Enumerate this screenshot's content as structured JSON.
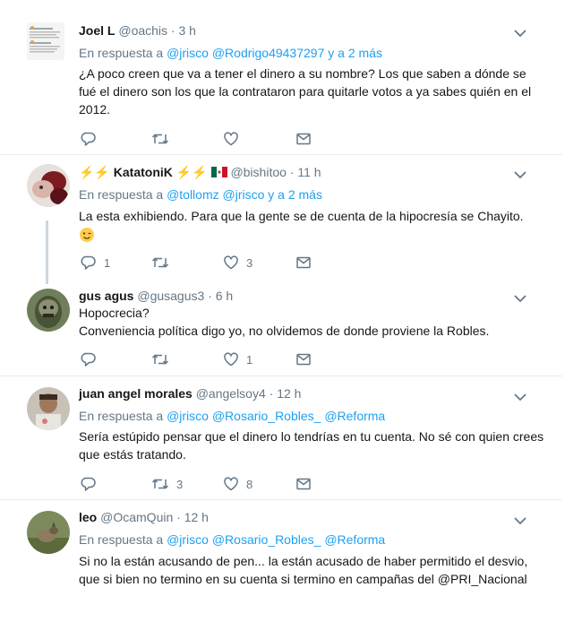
{
  "tweets": [
    {
      "name": "Joel L",
      "handle": "@oachis",
      "sep": "·",
      "time": "3 h",
      "reply_prefix": "En respuesta a",
      "reply_users": "@jrisco @Rodrigo49437297",
      "reply_suffix": "y a 2 más",
      "text": "¿A poco creen que va a tener el dinero a su nombre? Los que saben a dónde se fué el dinero son los que la contrataron para quitarle votos a ya sabes quién en el 2012.",
      "retweets": "",
      "likes": ""
    },
    {
      "name_emoji_pre": "⚡⚡",
      "name": "KatatoniK",
      "name_emoji_post": "⚡⚡",
      "handle": "@bishitoo",
      "sep": "·",
      "time": "11 h",
      "reply_prefix": "En respuesta a",
      "reply_users": "@tollomz @jrisco",
      "reply_suffix": "y a 2 más",
      "text": "La esta exhibiendo. Para que la gente se de cuenta de la hipocresía se Chayito.",
      "replies": "1",
      "retweets": "",
      "likes": "3"
    },
    {
      "name": "gus agus",
      "handle": "@gusagus3",
      "sep": "·",
      "time": "6 h",
      "text_line1": "Hopocrecia?",
      "text_line2": "Conveniencia política digo yo, no olvidemos de donde proviene la Robles.",
      "replies": "",
      "likes": "1"
    },
    {
      "name": "juan angel morales",
      "handle": "@angelsoy4",
      "sep": "·",
      "time": "12 h",
      "reply_prefix": "En respuesta a",
      "reply_users": "@jrisco @Rosario_Robles_ @Reforma",
      "text": "Sería estúpido pensar que el dinero lo tendrías en tu cuenta. No sé con quien crees que estás tratando.",
      "retweets": "3",
      "likes": "8"
    },
    {
      "name": "leo",
      "handle": "@OcamQuin",
      "sep": "·",
      "time": "12 h",
      "reply_prefix": "En respuesta a",
      "reply_users": "@jrisco @Rosario_Robles_ @Reforma",
      "text_line1": "Si no la están acusando de pen... la están acusado de haber permitido el desvio,",
      "text_line2": "que si bien no termino en su cuenta si termino en campañas del @PRI_Nacional"
    }
  ],
  "icons": {
    "reply": "reply-icon",
    "retweet": "retweet-icon",
    "like": "heart-icon",
    "message": "envelope-icon",
    "more": "chevron-down-icon"
  },
  "colors": {
    "link": "#1da1f2",
    "muted": "#657786",
    "lightning": "#f5a623",
    "divider": "#e6ecf0"
  }
}
